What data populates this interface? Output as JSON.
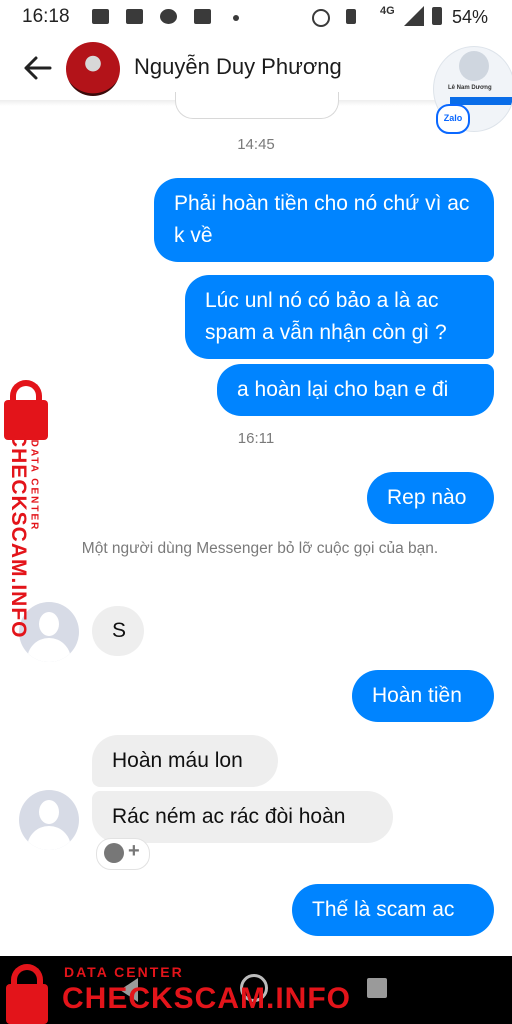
{
  "status_bar": {
    "time": "16:18",
    "network": "4G",
    "battery": "54%"
  },
  "header": {
    "contact_name": "Nguyễn Duy Phương"
  },
  "chat_head": {
    "name": "Lê Nam Dương",
    "badge": "Zalo"
  },
  "messages": {
    "ts1": "14:45",
    "m1": "Phải hoàn tiền cho nó chứ vì ac k về",
    "m2": "Lúc unl nó có bảo a là ac spam a vẫn nhận còn gì ?",
    "m3": "a hoàn lại cho bạn e đi",
    "ts2": "16:11",
    "m4": "Rep nào",
    "missed_call_note": "Một người dùng Messenger bỏ lỡ cuộc gọi của bạn.",
    "m5": "S",
    "m6": "Hoàn tiền",
    "m7": "Hoàn máu lon",
    "m8": "Rác ném ac rác đòi hoàn",
    "m9": "Thế là scam ac"
  },
  "watermark": {
    "small": "DATA CENTER",
    "big": "CHECKSCAM.INFO"
  },
  "colors": {
    "outgoing": "#0084ff",
    "incoming": "#eeeeee",
    "watermark": "#e3141a"
  }
}
